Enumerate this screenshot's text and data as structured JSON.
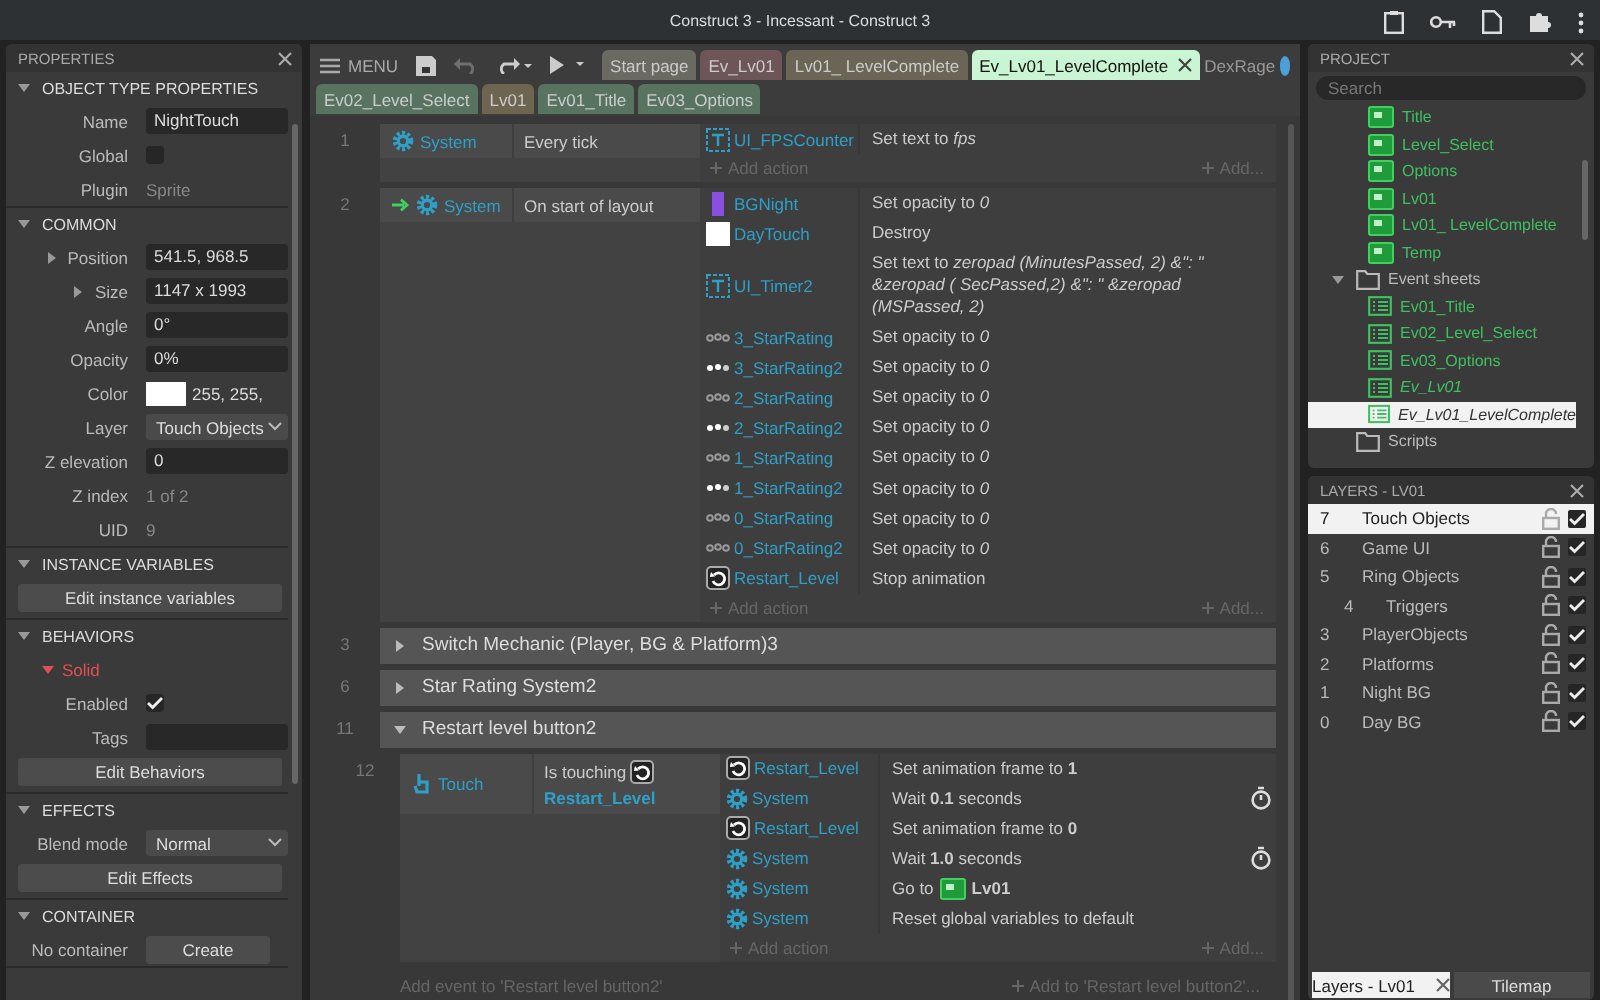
{
  "window": {
    "title": "Construct 3 - Incessant - Construct 3"
  },
  "toolbar": {
    "menu_label": "MENU",
    "undo_disabled": true,
    "user": "DexRage"
  },
  "tabs": [
    {
      "label": "Start page",
      "color": "#6a6a62",
      "selected": false
    },
    {
      "label": "Ev_Lv01",
      "color": "#6e5658",
      "selected": false
    },
    {
      "label": "Lv01_ LevelComplete",
      "color": "#6b6555",
      "selected": false
    },
    {
      "label": "Ev_Lv01_LevelComplete",
      "color": "#c9f5d2",
      "selected": true
    },
    {
      "label": "Ev02_Level_Select",
      "color": "#587461",
      "selected": false
    },
    {
      "label": "Lv01",
      "color": "#6d6550",
      "selected": false
    },
    {
      "label": "Ev01_Title",
      "color": "#587461",
      "selected": false
    },
    {
      "label": "Ev03_Options",
      "color": "#587461",
      "selected": false
    }
  ],
  "properties": {
    "title": "PROPERTIES",
    "sections": [
      {
        "title": "OBJECT TYPE PROPERTIES",
        "rows": [
          {
            "kind": "input",
            "label": "Name",
            "value": "NightTouch"
          },
          {
            "kind": "checkbox",
            "label": "Global",
            "checked": false
          },
          {
            "kind": "text",
            "label": "Plugin",
            "value": "Sprite"
          }
        ]
      },
      {
        "title": "COMMON",
        "rows": [
          {
            "kind": "vector",
            "label": "Position",
            "value": "541.5, 968.5"
          },
          {
            "kind": "vector",
            "label": "Size",
            "value": "1147 x 1993"
          },
          {
            "kind": "input",
            "label": "Angle",
            "value": "0°"
          },
          {
            "kind": "input",
            "label": "Opacity",
            "value": "0%"
          },
          {
            "kind": "color",
            "label": "Color",
            "value": "255, 255,"
          },
          {
            "kind": "select",
            "label": "Layer",
            "value": "Touch Objects"
          },
          {
            "kind": "input",
            "label": "Z elevation",
            "value": "0"
          },
          {
            "kind": "text",
            "label": "Z index",
            "value": "1 of 2"
          },
          {
            "kind": "text",
            "label": "UID",
            "value": "9"
          }
        ]
      },
      {
        "title": "INSTANCE VARIABLES",
        "rows": [
          {
            "kind": "button",
            "label": "Edit instance variables"
          }
        ]
      },
      {
        "title": "BEHAVIORS",
        "rows": [
          {
            "kind": "behavior",
            "label": "Solid"
          },
          {
            "kind": "checkbox",
            "label": "Enabled",
            "checked": true
          },
          {
            "kind": "input",
            "label": "Tags"
          },
          {
            "kind": "button",
            "label": "Edit Behaviors"
          }
        ]
      },
      {
        "title": "EFFECTS",
        "rows": [
          {
            "kind": "select",
            "label": "Blend mode",
            "value": "Normal"
          },
          {
            "kind": "button",
            "label": "Edit Effects"
          }
        ]
      },
      {
        "title": "CONTAINER",
        "rows": [
          {
            "kind": "action",
            "label": "No container",
            "value": "Create"
          }
        ]
      }
    ]
  },
  "events": [
    {
      "kind": "event",
      "number": "1",
      "trigger": false,
      "conditions": [
        {
          "object": "System",
          "kind": "system",
          "text": "Every tick"
        }
      ],
      "actions": [
        {
          "object": "UI_FPSCounter",
          "kind": "text",
          "text": "Set text to *fps*"
        }
      ],
      "add_action": "Add action",
      "add_more": "Add..."
    },
    {
      "kind": "event",
      "number": "2",
      "trigger": true,
      "conditions": [
        {
          "object": "System",
          "kind": "system",
          "text": "On start of layout"
        }
      ],
      "actions": [
        {
          "object": "BGNight",
          "kind": "sprite",
          "text": "Set opacity to *0*"
        },
        {
          "object": "DayTouch",
          "kind": "tile",
          "text": "Destroy"
        },
        {
          "object": "UI_Timer2",
          "kind": "text",
          "text": "Set text to *zeropad (MinutesPassed, 2) &\": \" &zeropad ( SecPassed,2) &\": \" &zeropad (MSPassed, 2)*"
        },
        {
          "object": "3_StarRating",
          "kind": "outline",
          "text": "Set opacity to *0*"
        },
        {
          "object": "3_StarRating2",
          "kind": "filled",
          "text": "Set opacity to *0*"
        },
        {
          "object": "2_StarRating",
          "kind": "outline",
          "text": "Set opacity to *0*"
        },
        {
          "object": "2_StarRating2",
          "kind": "filled",
          "text": "Set opacity to *0*"
        },
        {
          "object": "1_StarRating",
          "kind": "outline",
          "text": "Set opacity to *0*"
        },
        {
          "object": "1_StarRating2",
          "kind": "filled",
          "text": "Set opacity to *0*"
        },
        {
          "object": "0_StarRating",
          "kind": "outline",
          "text": "Set opacity to *0*"
        },
        {
          "object": "0_StarRating2",
          "kind": "outline",
          "text": "Set opacity to *0*"
        },
        {
          "object": "Restart_Level",
          "kind": "button",
          "text": "Stop animation"
        }
      ],
      "add_action": "Add action",
      "add_more": "Add..."
    },
    {
      "kind": "group",
      "number": "3",
      "title": "Switch Mechanic (Player, BG & Platform)3",
      "expanded": false
    },
    {
      "kind": "group",
      "number": "6",
      "title": "Star Rating System2",
      "expanded": false
    },
    {
      "kind": "group",
      "number": "11",
      "title": "Restart level button2",
      "expanded": true,
      "children": [
        {
          "kind": "event",
          "number": "12",
          "trigger": false,
          "conditions": [
            {
              "object": "Touch",
              "kind": "touch",
              "text": "Is touching",
              "param": "Restart_Level"
            }
          ],
          "actions": [
            {
              "object": "Restart_Level",
              "kind": "button",
              "text": "Set animation frame to **1**",
              "timer": false
            },
            {
              "object": "System",
              "kind": "system",
              "text": "Wait **0.1** seconds",
              "timer": true
            },
            {
              "object": "Restart_Level",
              "kind": "button",
              "text": "Set animation frame to **0**",
              "timer": false
            },
            {
              "object": "System",
              "kind": "system",
              "text": "Wait **1.0** seconds",
              "timer": true
            },
            {
              "object": "System",
              "kind": "system",
              "text": "Go to",
              "param": "Lv01",
              "timer": false
            },
            {
              "object": "System",
              "kind": "system",
              "text": "Reset global variables to default",
              "timer": false
            }
          ],
          "add_action": "Add action",
          "add_more": "Add..."
        }
      ],
      "add_event": "Add event to 'Restart level button2'",
      "add_to": "Add to 'Restart level button2'..."
    }
  ],
  "project": {
    "title": "PROJECT",
    "search": {
      "placeholder": "Search"
    },
    "layouts": [
      {
        "name": "Title"
      },
      {
        "name": "Level_Select"
      },
      {
        "name": "Options"
      },
      {
        "name": "Lv01"
      },
      {
        "name": "Lv01_ LevelComplete"
      },
      {
        "name": "Temp"
      }
    ],
    "folders": [
      {
        "name": "Event sheets",
        "expanded": true,
        "children": [
          {
            "name": "Ev01_Title",
            "open": false,
            "selected": false
          },
          {
            "name": "Ev02_Level_Select",
            "open": false,
            "selected": false
          },
          {
            "name": "Ev03_Options",
            "open": false,
            "selected": false
          },
          {
            "name": "Ev_Lv01",
            "open": true,
            "selected": false
          },
          {
            "name": "Ev_Lv01_LevelComplete",
            "open": true,
            "selected": true
          }
        ]
      },
      {
        "name": "Scripts",
        "expanded": false
      }
    ]
  },
  "layers": {
    "title": "LAYERS - LV01",
    "items": [
      {
        "number": "7",
        "name": "Touch Objects",
        "selected": true,
        "visible": true
      },
      {
        "number": "6",
        "name": "Game UI",
        "selected": false,
        "visible": true
      },
      {
        "number": "5",
        "name": "Ring Objects",
        "selected": false,
        "visible": true,
        "children": [
          {
            "number": "4",
            "name": "Triggers",
            "selected": false,
            "visible": true
          }
        ]
      },
      {
        "number": "3",
        "name": "PlayerObjects",
        "selected": false,
        "visible": true
      },
      {
        "number": "2",
        "name": "Platforms",
        "selected": false,
        "visible": true
      },
      {
        "number": "1",
        "name": "Night BG",
        "selected": false,
        "visible": true
      },
      {
        "number": "0",
        "name": "Day BG",
        "selected": false,
        "visible": true
      }
    ],
    "tabs": [
      {
        "label": "Layers - Lv01",
        "selected": true
      },
      {
        "label": "Tilemap",
        "selected": false
      }
    ]
  }
}
